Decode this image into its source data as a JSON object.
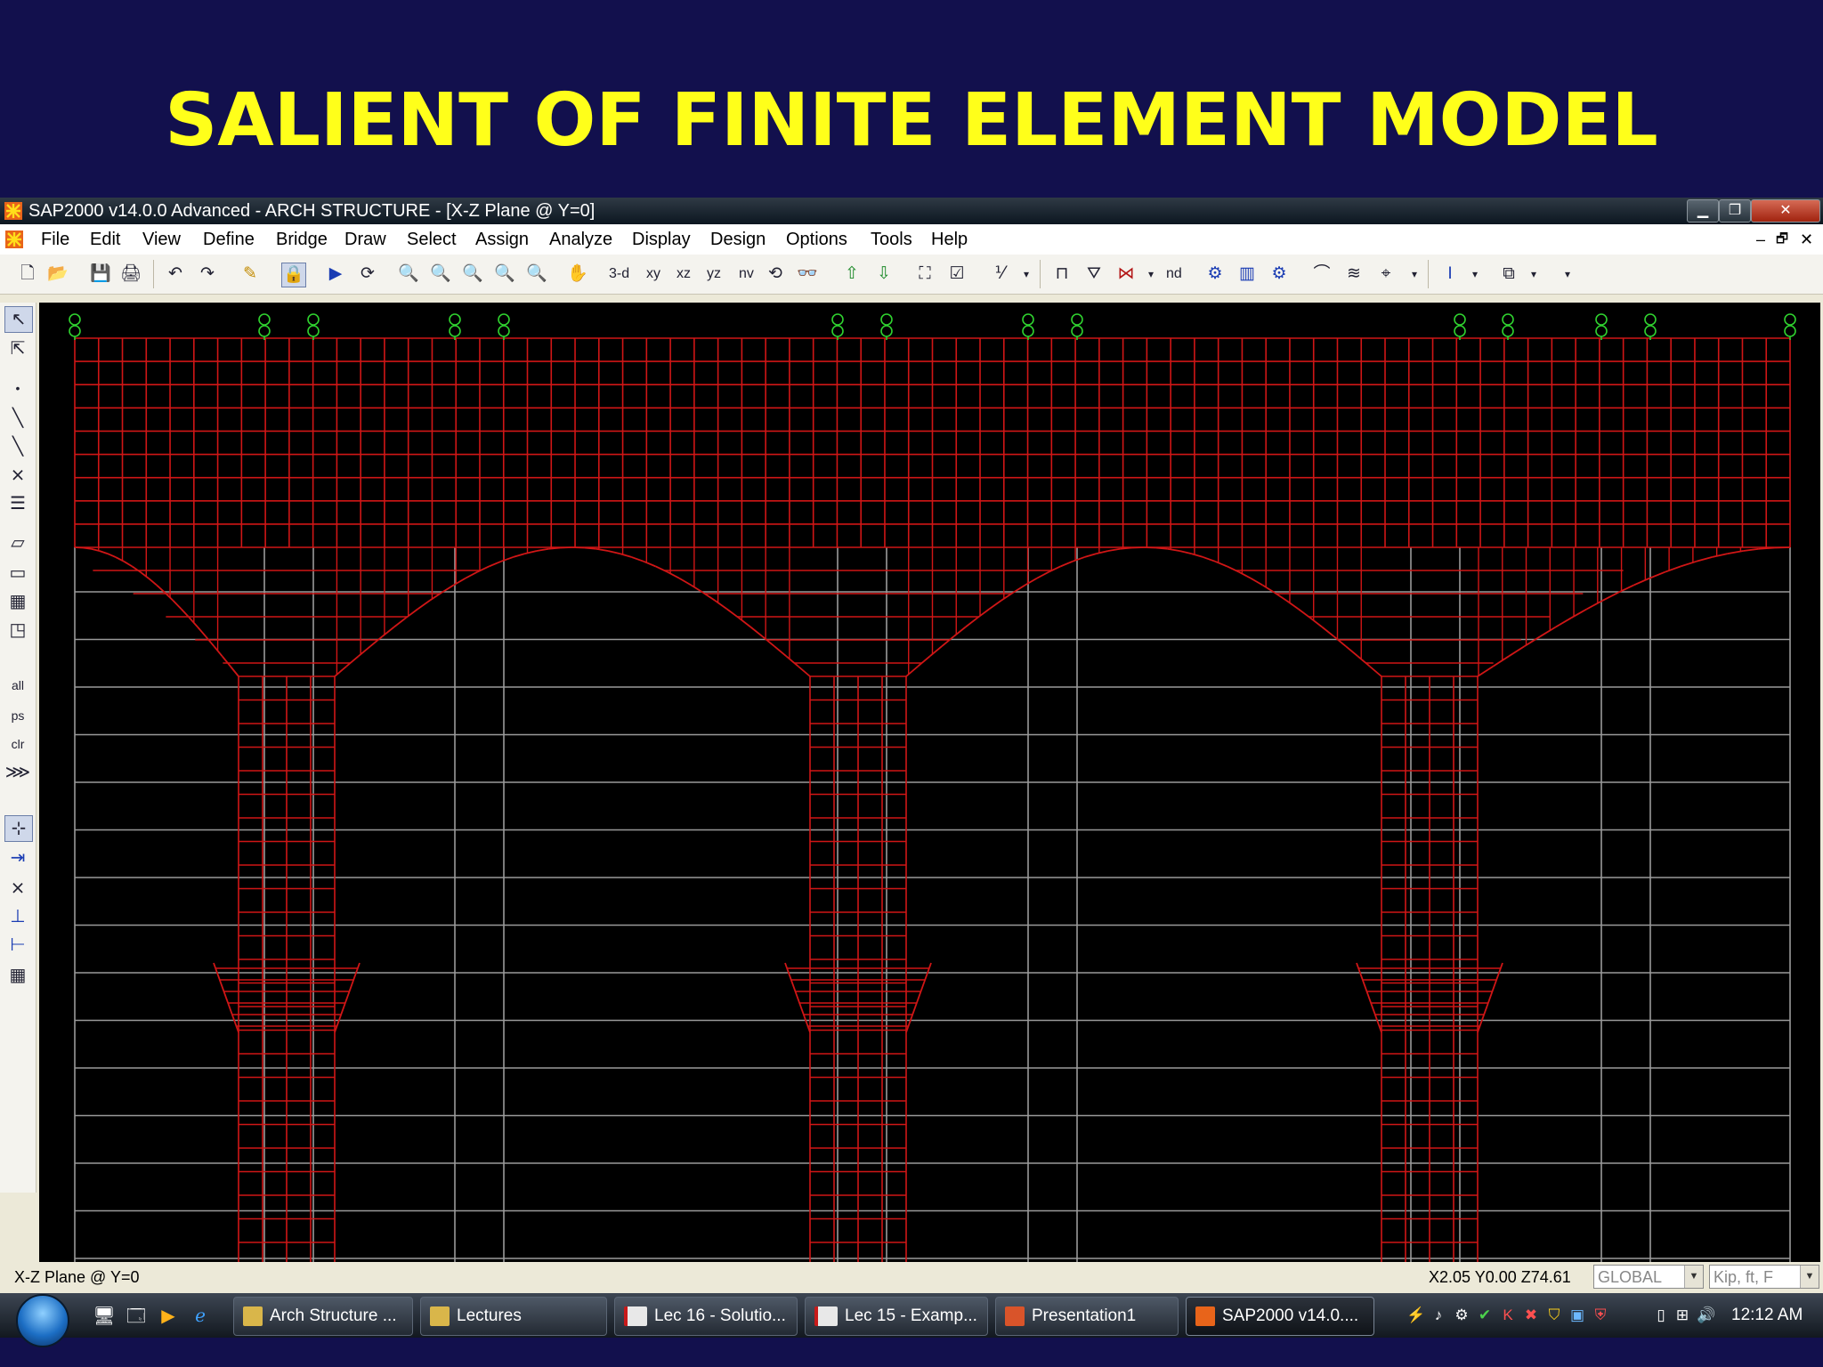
{
  "slide": {
    "title": "SALIENT OF FINITE ELEMENT MODEL"
  },
  "window": {
    "title": "SAP2000 v14.0.0 Advanced  - ARCH STRUCTURE - [X-Z Plane @ Y=0]",
    "controls": {
      "minimize": "▁",
      "maximize": "❐",
      "close": "✕"
    }
  },
  "menu": {
    "items": [
      "File",
      "Edit",
      "View",
      "Define",
      "Bridge",
      "Draw",
      "Select",
      "Assign",
      "Analyze",
      "Display",
      "Design",
      "Options",
      "Tools",
      "Help"
    ],
    "mdi_controls": {
      "minimize": "–",
      "restore": "🗗",
      "close": "✕"
    }
  },
  "toolbar": {
    "view_buttons": [
      "3-d",
      "xy",
      "xz",
      "yz",
      "nv"
    ],
    "nd_label": "nd"
  },
  "left_toolbar": {
    "all_label": "all",
    "ps_label": "ps",
    "clr_label": "clr"
  },
  "status": {
    "plane": "X-Z Plane @ Y=0",
    "coords": "X2.05  Y0.00  Z74.61",
    "coord_system": "GLOBAL",
    "units": "Kip, ft, F"
  },
  "taskbar": {
    "tasks": [
      {
        "label": "Arch Structure ...",
        "icon": "folder-icon"
      },
      {
        "label": "Lectures",
        "icon": "folder-icon"
      },
      {
        "label": "Lec 16 - Solutio...",
        "icon": "pdf-icon"
      },
      {
        "label": "Lec 15 - Examp...",
        "icon": "pdf-icon"
      },
      {
        "label": "Presentation1",
        "icon": "powerpoint-icon"
      },
      {
        "label": "SAP2000 v14.0....",
        "icon": "sap2000-icon"
      }
    ],
    "clock": "12:12 AM"
  },
  "colors": {
    "slide_background": "#12104d",
    "title_color": "#ffff1a",
    "mesh_color": "#d01616",
    "grid_color": "#9a9a9a",
    "canvas_background": "#000000",
    "grid_bubble_color": "#2fd12f"
  }
}
